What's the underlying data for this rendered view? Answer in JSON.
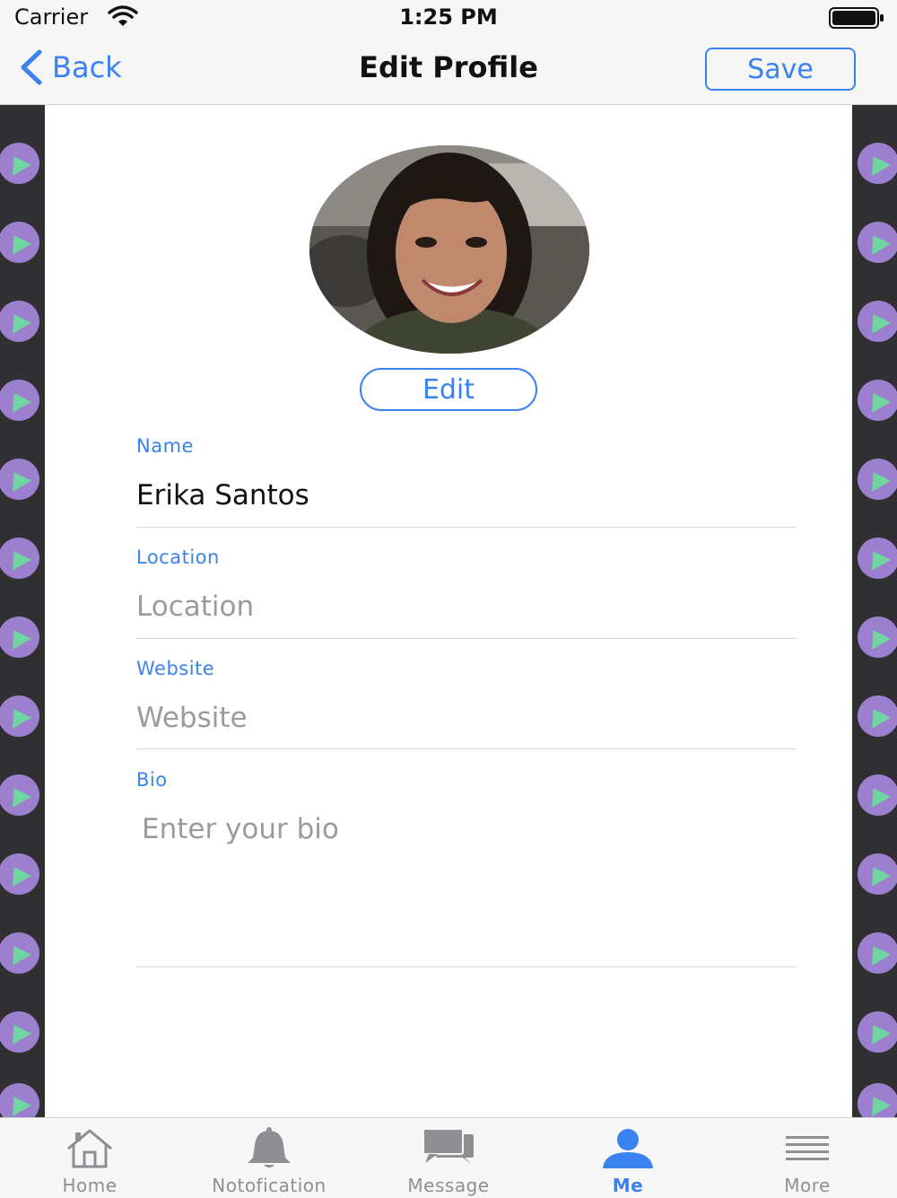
{
  "status_bar": {
    "carrier": "Carrier",
    "time": "1:25 PM"
  },
  "nav": {
    "back_label": "Back",
    "title": "Edit Profile",
    "save_label": "Save"
  },
  "profile": {
    "edit_photo_label": "Edit",
    "fields": {
      "name": {
        "label": "Name",
        "value": "Erika Santos"
      },
      "location": {
        "label": "Location",
        "placeholder": "Location"
      },
      "website": {
        "label": "Website",
        "placeholder": "Website"
      },
      "bio": {
        "label": "Bio",
        "placeholder": "Enter your bio"
      }
    }
  },
  "tab_bar": {
    "items": [
      {
        "label": "Home",
        "icon": "home-icon"
      },
      {
        "label": "Notofication",
        "icon": "bell-icon"
      },
      {
        "label": "Message",
        "icon": "chat-bubbles-icon"
      },
      {
        "label": "Me",
        "icon": "person-icon"
      },
      {
        "label": "More",
        "icon": "menu-lines-icon"
      }
    ],
    "active_index": 3
  },
  "colors": {
    "accent": "#3a82f0",
    "side_strip": "#303032",
    "dot_purple": "#9d7fd0",
    "dot_green": "#6fd6a0"
  }
}
